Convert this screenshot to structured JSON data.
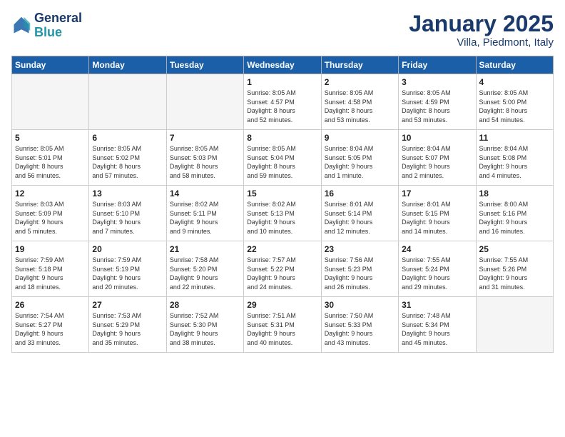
{
  "logo": {
    "line1": "General",
    "line2": "Blue"
  },
  "title": "January 2025",
  "subtitle": "Villa, Piedmont, Italy",
  "header": {
    "days": [
      "Sunday",
      "Monday",
      "Tuesday",
      "Wednesday",
      "Thursday",
      "Friday",
      "Saturday"
    ]
  },
  "weeks": [
    [
      {
        "day": "",
        "info": ""
      },
      {
        "day": "",
        "info": ""
      },
      {
        "day": "",
        "info": ""
      },
      {
        "day": "1",
        "info": "Sunrise: 8:05 AM\nSunset: 4:57 PM\nDaylight: 8 hours\nand 52 minutes."
      },
      {
        "day": "2",
        "info": "Sunrise: 8:05 AM\nSunset: 4:58 PM\nDaylight: 8 hours\nand 53 minutes."
      },
      {
        "day": "3",
        "info": "Sunrise: 8:05 AM\nSunset: 4:59 PM\nDaylight: 8 hours\nand 53 minutes."
      },
      {
        "day": "4",
        "info": "Sunrise: 8:05 AM\nSunset: 5:00 PM\nDaylight: 8 hours\nand 54 minutes."
      }
    ],
    [
      {
        "day": "5",
        "info": "Sunrise: 8:05 AM\nSunset: 5:01 PM\nDaylight: 8 hours\nand 56 minutes."
      },
      {
        "day": "6",
        "info": "Sunrise: 8:05 AM\nSunset: 5:02 PM\nDaylight: 8 hours\nand 57 minutes."
      },
      {
        "day": "7",
        "info": "Sunrise: 8:05 AM\nSunset: 5:03 PM\nDaylight: 8 hours\nand 58 minutes."
      },
      {
        "day": "8",
        "info": "Sunrise: 8:05 AM\nSunset: 5:04 PM\nDaylight: 8 hours\nand 59 minutes."
      },
      {
        "day": "9",
        "info": "Sunrise: 8:04 AM\nSunset: 5:05 PM\nDaylight: 9 hours\nand 1 minute."
      },
      {
        "day": "10",
        "info": "Sunrise: 8:04 AM\nSunset: 5:07 PM\nDaylight: 9 hours\nand 2 minutes."
      },
      {
        "day": "11",
        "info": "Sunrise: 8:04 AM\nSunset: 5:08 PM\nDaylight: 9 hours\nand 4 minutes."
      }
    ],
    [
      {
        "day": "12",
        "info": "Sunrise: 8:03 AM\nSunset: 5:09 PM\nDaylight: 9 hours\nand 5 minutes."
      },
      {
        "day": "13",
        "info": "Sunrise: 8:03 AM\nSunset: 5:10 PM\nDaylight: 9 hours\nand 7 minutes."
      },
      {
        "day": "14",
        "info": "Sunrise: 8:02 AM\nSunset: 5:11 PM\nDaylight: 9 hours\nand 9 minutes."
      },
      {
        "day": "15",
        "info": "Sunrise: 8:02 AM\nSunset: 5:13 PM\nDaylight: 9 hours\nand 10 minutes."
      },
      {
        "day": "16",
        "info": "Sunrise: 8:01 AM\nSunset: 5:14 PM\nDaylight: 9 hours\nand 12 minutes."
      },
      {
        "day": "17",
        "info": "Sunrise: 8:01 AM\nSunset: 5:15 PM\nDaylight: 9 hours\nand 14 minutes."
      },
      {
        "day": "18",
        "info": "Sunrise: 8:00 AM\nSunset: 5:16 PM\nDaylight: 9 hours\nand 16 minutes."
      }
    ],
    [
      {
        "day": "19",
        "info": "Sunrise: 7:59 AM\nSunset: 5:18 PM\nDaylight: 9 hours\nand 18 minutes."
      },
      {
        "day": "20",
        "info": "Sunrise: 7:59 AM\nSunset: 5:19 PM\nDaylight: 9 hours\nand 20 minutes."
      },
      {
        "day": "21",
        "info": "Sunrise: 7:58 AM\nSunset: 5:20 PM\nDaylight: 9 hours\nand 22 minutes."
      },
      {
        "day": "22",
        "info": "Sunrise: 7:57 AM\nSunset: 5:22 PM\nDaylight: 9 hours\nand 24 minutes."
      },
      {
        "day": "23",
        "info": "Sunrise: 7:56 AM\nSunset: 5:23 PM\nDaylight: 9 hours\nand 26 minutes."
      },
      {
        "day": "24",
        "info": "Sunrise: 7:55 AM\nSunset: 5:24 PM\nDaylight: 9 hours\nand 29 minutes."
      },
      {
        "day": "25",
        "info": "Sunrise: 7:55 AM\nSunset: 5:26 PM\nDaylight: 9 hours\nand 31 minutes."
      }
    ],
    [
      {
        "day": "26",
        "info": "Sunrise: 7:54 AM\nSunset: 5:27 PM\nDaylight: 9 hours\nand 33 minutes."
      },
      {
        "day": "27",
        "info": "Sunrise: 7:53 AM\nSunset: 5:29 PM\nDaylight: 9 hours\nand 35 minutes."
      },
      {
        "day": "28",
        "info": "Sunrise: 7:52 AM\nSunset: 5:30 PM\nDaylight: 9 hours\nand 38 minutes."
      },
      {
        "day": "29",
        "info": "Sunrise: 7:51 AM\nSunset: 5:31 PM\nDaylight: 9 hours\nand 40 minutes."
      },
      {
        "day": "30",
        "info": "Sunrise: 7:50 AM\nSunset: 5:33 PM\nDaylight: 9 hours\nand 43 minutes."
      },
      {
        "day": "31",
        "info": "Sunrise: 7:48 AM\nSunset: 5:34 PM\nDaylight: 9 hours\nand 45 minutes."
      },
      {
        "day": "",
        "info": ""
      }
    ]
  ]
}
